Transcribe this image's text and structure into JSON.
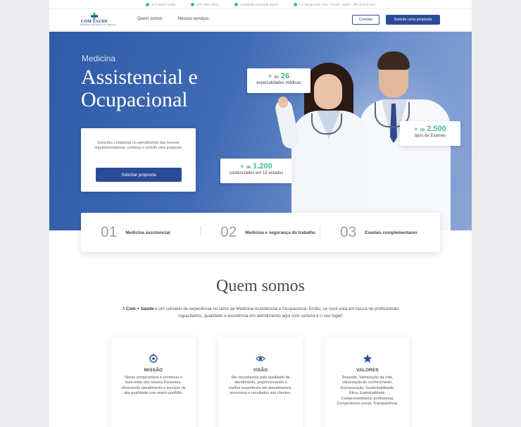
{
  "topbar": {
    "phone": "(47) 98117-3296",
    "whatsapp": "(47) 3801-9922",
    "email": "contato@comsaude.org.br",
    "address": "Av. Tamandaré, 443 - Centro, Mafra - PR, 87013-210"
  },
  "nav": {
    "logo_text": "COM SAÚDE",
    "logo_tagline": "MEDICINA E SEGURANÇA DO TRABALHO",
    "links": [
      "Quem somos",
      "Nossos serviços"
    ],
    "contact_label": "Contato",
    "proposal_label": "Solicite uma proposta"
  },
  "hero": {
    "kicker": "Medicina",
    "title_line1": "Assistencial e",
    "title_line2": "Ocupacional",
    "card_text": "Soluções completas no atendimento das normas regulamentadoras, conheça e solicite uma proposta.",
    "card_cta": "Solicitar proposta",
    "stats": [
      {
        "prefix": "de",
        "value": "26",
        "label": "especialidades médicas"
      },
      {
        "prefix": "de",
        "value": "2.500",
        "label": "tipos de Exames"
      },
      {
        "prefix": "de",
        "value": "1.200",
        "label": "credenciados em 15 estados"
      }
    ]
  },
  "steps": [
    {
      "number": "01",
      "label": "Medicina assistencial"
    },
    {
      "number": "02",
      "label": "Medicina e segurança do trabalho"
    },
    {
      "number": "03",
      "label": "Exames complementares"
    }
  ],
  "about": {
    "title": "Quem somos",
    "text_prefix": "A ",
    "brand": "Com + Saúde",
    "text_rest": " é um conceito de experiência no ramo de Medicina Assistencial e Ocupacional. Então, se você está em busca de profissionais capacitados, qualidade e excelência em atendimento aqui com certeza é o seu lugar!",
    "cards": [
      {
        "icon": "target-icon",
        "title": "MISSÃO",
        "text": "Nosso compromisso é promover o bem-estar dos nossos Pacientes, oferecendo atendimento e serviços de alta qualidade com amplo portfólio."
      },
      {
        "icon": "eye-icon",
        "title": "VISÃO",
        "text": "Ser reconhecida pela qualidade de atendimento, proporcionando a melhor experiência em atendimentos, processos e resultados aos clientes."
      },
      {
        "icon": "star-icon",
        "title": "VALORES",
        "text": "Respeito, Valorização da vida, Valorização do conhecimento, Humanização, Sustentabilidade, Ética, Espiritualidade, Comprometimento profissional, Compromisso social, Transparência."
      }
    ]
  },
  "colors": {
    "primary": "#2a4c98",
    "accent": "#3fbf8c"
  }
}
